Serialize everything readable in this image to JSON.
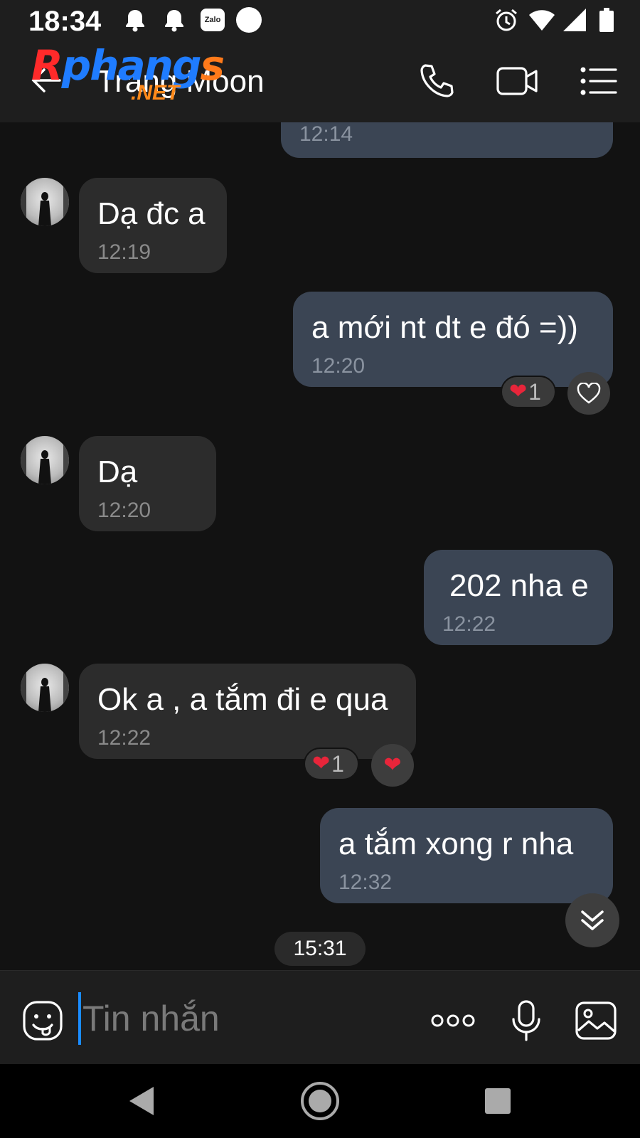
{
  "status_bar": {
    "time": "18:34",
    "notification_app_badge": "Zalo",
    "icons": [
      "bell-icon",
      "bell-icon",
      "zalo-icon",
      "circle-icon",
      "alarm-icon",
      "wifi-icon",
      "signal-icon",
      "battery-icon"
    ]
  },
  "header": {
    "contact_name": "Trang Moon",
    "watermark": {
      "main": "Rphangs",
      "sub": ".NET"
    },
    "actions": [
      "phone-icon",
      "video-call-icon",
      "menu-list-icon"
    ]
  },
  "messages": [
    {
      "direction": "out",
      "text": "",
      "time": "12:14"
    },
    {
      "direction": "in",
      "text": "Dạ đc a",
      "time": "12:19"
    },
    {
      "direction": "out",
      "text": "a mới nt dt e đó =))",
      "time": "12:20",
      "reaction_count": "1"
    },
    {
      "direction": "in",
      "text": "Dạ",
      "time": "12:20"
    },
    {
      "direction": "out",
      "text": "202 nha e",
      "time": "12:22"
    },
    {
      "direction": "in",
      "text": "Ok a , a tắm đi e qua",
      "time": "12:22",
      "reaction_count": "1"
    },
    {
      "direction": "out",
      "text": "a tắm xong r nha",
      "time": "12:32"
    }
  ],
  "time_separator": "15:31",
  "input": {
    "placeholder": "Tin nhắn",
    "value": ""
  },
  "colors": {
    "background": "#121212",
    "outgoing_bubble": "#3b4554",
    "incoming_bubble": "#2c2c2c",
    "reaction_heart": "#e8253a",
    "cursor_accent": "#1a8cff"
  }
}
